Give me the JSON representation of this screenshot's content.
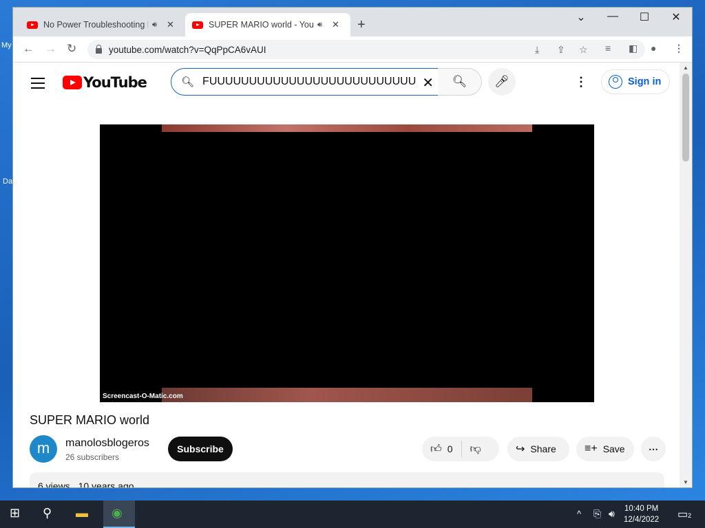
{
  "browser": {
    "tabs": [
      {
        "title": "No Power Troubleshooting D",
        "audio_icon": "speaker-icon",
        "active": false
      },
      {
        "title": "SUPER MARIO world - YouTu",
        "audio_icon": "speaker-icon",
        "active": true
      }
    ],
    "url": "youtube.com/watch?v=QqPpCA6vAUI"
  },
  "youtube": {
    "logo_text": "YouTube",
    "search_value": "FUUUUUUUUUUUUUUUUUUUUUUUUUUUUUU",
    "signin_label": "Sign in"
  },
  "video": {
    "watermark": "Screencast-O-Matic.com",
    "title": "SUPER MARIO world",
    "channel_initial": "m",
    "channel_name": "manolosblogeros",
    "subscribers": "26 subscribers",
    "subscribe_label": "Subscribe",
    "likes": "0",
    "share_label": "Share",
    "save_label": "Save",
    "views": "6 views",
    "age": "10 years ago"
  },
  "desktop": {
    "labels": [
      "My",
      "Da"
    ]
  },
  "taskbar": {
    "time": "10:40 PM",
    "date": "12/4/2022",
    "notification_count": "2"
  },
  "colors": {
    "youtube_red": "#ff0000",
    "link_blue": "#065fd4",
    "taskbar": "#1c2530"
  }
}
